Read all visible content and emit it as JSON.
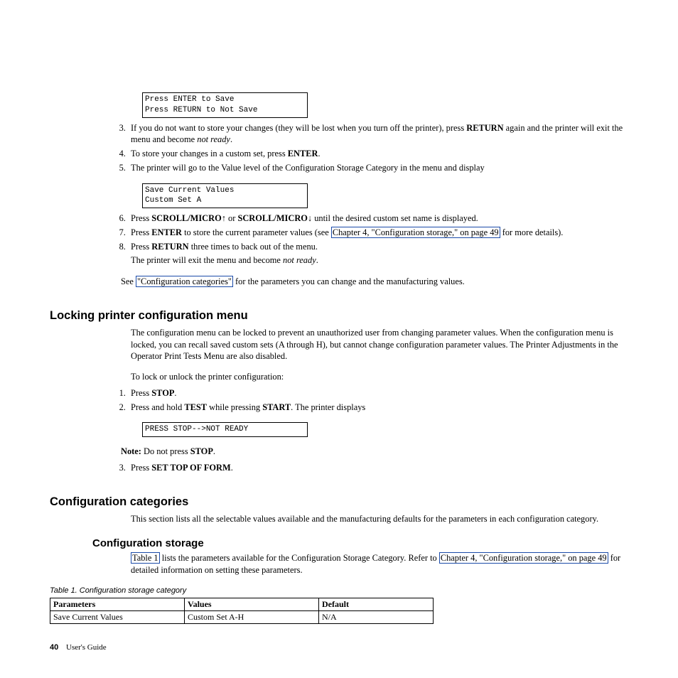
{
  "display1_line1": "Press ENTER to Save",
  "display1_line2": "Press RETURN to Not Save",
  "display2_line1": "Save Current Values",
  "display2_line2": "Custom Set A",
  "display3_line1": "PRESS STOP-->NOT READY",
  "step3_a": "If you do not want to store your changes (they will be lost when you turn off the printer), press ",
  "step3_b": "RETURN",
  "step3_c": " again and the printer will exit the menu and become ",
  "step3_d": "not ready",
  "step3_e": ".",
  "step4_a": "To store your changes in a custom set, press ",
  "step4_b": "ENTER",
  "step4_c": ".",
  "step5": "The printer will go to the Value level of the Configuration Storage Category in the menu and display",
  "step6_a": "Press ",
  "step6_b": "SCROLL/MICRO",
  "step6_c": " or ",
  "step6_d": "SCROLL/MICRO",
  "step6_e": " until the desired custom set name is displayed.",
  "step7_a": "Press ",
  "step7_b": "ENTER",
  "step7_c": " to store the current parameter values (see ",
  "step7_link": "Chapter 4, \"Configuration storage,\" on page 49",
  "step7_d": " for more details).",
  "step8_a": "Press ",
  "step8_b": "RETURN",
  "step8_c": " three times to back out of the menu.",
  "step8_sub_a": "The printer will exit the menu and become ",
  "step8_sub_b": "not ready",
  "step8_sub_c": ".",
  "see_a": "See ",
  "see_link": "\"Configuration categories\"",
  "see_b": " for the parameters you can change and the manufacturing values.",
  "h1_lock": "Locking printer configuration menu",
  "lock_para": "The configuration menu can be locked to prevent an unauthorized user from changing parameter values. When the configuration menu is locked, you can recall saved custom sets (A through H), but cannot change configuration parameter values. The Printer Adjustments in the Operator Print Tests Menu are also disabled.",
  "lock_intro": "To lock or unlock the printer configuration:",
  "lock1_a": "Press ",
  "lock1_b": "STOP",
  "lock1_c": ".",
  "lock2_a": "Press and hold ",
  "lock2_b": "TEST",
  "lock2_c": " while pressing ",
  "lock2_d": "START",
  "lock2_e": ". The printer displays",
  "note_a": "Note: ",
  "note_b": "Do not press ",
  "note_c": "STOP",
  "note_d": ".",
  "lock3_a": "Press ",
  "lock3_b": "SET TOP OF FORM",
  "lock3_c": ".",
  "h1_cfg": "Configuration categories",
  "cfg_para": "This section lists all the selectable values available and the manufacturing defaults for the parameters in each configuration category.",
  "h2_storage": "Configuration storage",
  "stor_a": "",
  "stor_link1": "Table 1",
  "stor_b": " lists the parameters available for the Configuration Storage Category. Refer to ",
  "stor_link2": "Chapter 4, \"Configuration storage,\" on page 49",
  "stor_c": " for detailed information on setting these parameters.",
  "table_caption": "Table 1. Configuration storage category",
  "th1": "Parameters",
  "th2": "Values",
  "th3": "Default",
  "td1": "Save Current Values",
  "td2": "Custom Set A-H",
  "td3": "N/A",
  "page_number": "40",
  "page_label": "User's Guide",
  "arrow_up": "↑",
  "arrow_down": "↓"
}
